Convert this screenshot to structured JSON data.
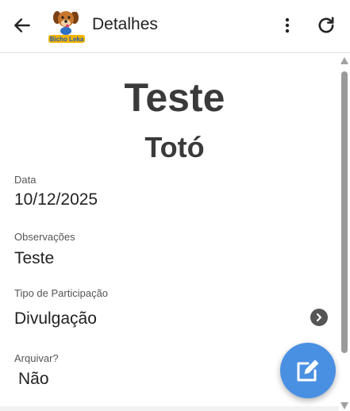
{
  "appbar": {
    "title": "Detalhes",
    "icons": {
      "back": "arrow-left-icon",
      "logo": "bicho-leka-logo",
      "menu": "more-vertical-icon",
      "refresh": "refresh-icon"
    },
    "logo_text": "Bicho Leka"
  },
  "header": {
    "title": "Teste",
    "subtitle": "Totó"
  },
  "fields": {
    "data": {
      "label": "Data",
      "value": "10/12/2025"
    },
    "observacoes": {
      "label": "Observações",
      "value": "Teste"
    },
    "tipo": {
      "label": "Tipo de Participação",
      "value": "Divulgação"
    },
    "arquivar": {
      "label": "Arquivar?",
      "value": "Não"
    }
  },
  "fab": {
    "icon": "edit-icon"
  },
  "colors": {
    "fab": "#4a90e2",
    "text": "#222222",
    "heading": "#3a3a3a",
    "chevron": "#555555"
  }
}
